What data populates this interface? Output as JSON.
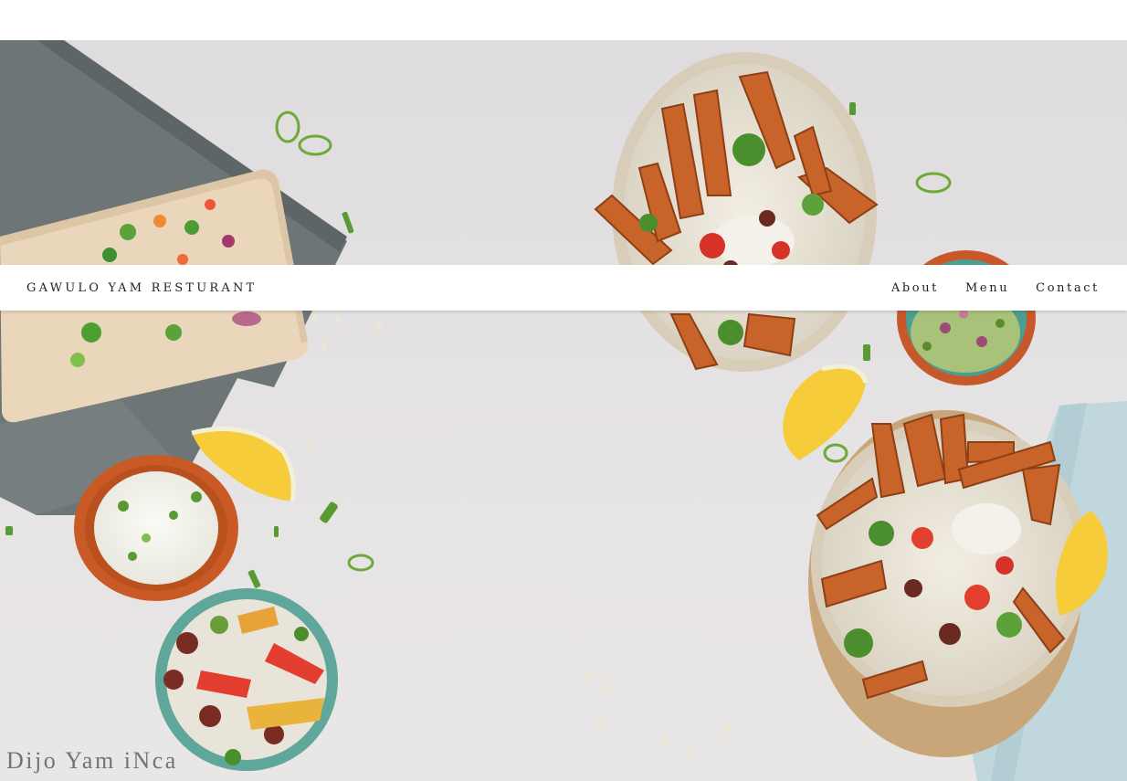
{
  "navbar": {
    "brand": "GAWULO YAM RESTURANT",
    "links": [
      "About",
      "Menu",
      "Contact"
    ]
  },
  "hero": {
    "image": "food-flatlay-photo",
    "dishes": [
      "sweet-potato-fries-bowl",
      "guacamole-bowl",
      "sour-cream-bowl",
      "bean-salad-bowl",
      "chopping-board",
      "lemon-wedge"
    ],
    "colors": {
      "background": "#e4e1e2",
      "napkin": "#6f7778",
      "board": "#e6d2b5",
      "fries": "#c8642a",
      "clay_bowl": "#c95a25",
      "teal_bowl": "#5fa79a"
    }
  },
  "footer": {
    "signature": "Dijo Yam iNca"
  }
}
